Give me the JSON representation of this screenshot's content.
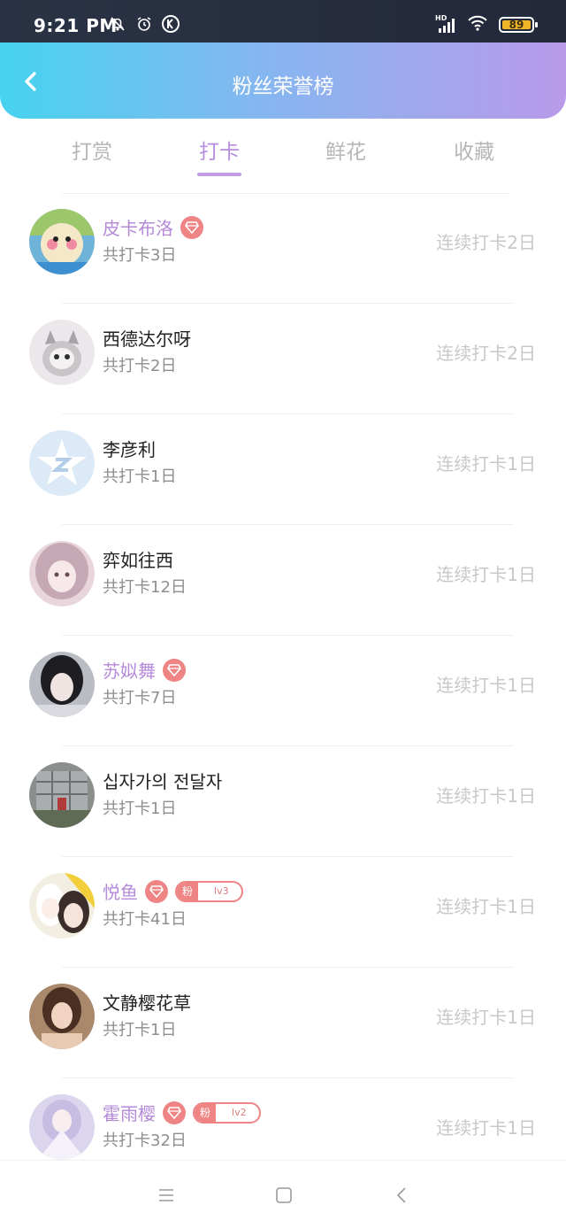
{
  "status_bar": {
    "time": "9:21 PM",
    "battery": "89",
    "hd": "HD",
    "battery_level_percent": 89
  },
  "header": {
    "title": "粉丝荣誉榜"
  },
  "tabs": [
    {
      "label": "打赏",
      "active": false
    },
    {
      "label": "打卡",
      "active": true
    },
    {
      "label": "鲜花",
      "active": false
    },
    {
      "label": "收藏",
      "active": false
    }
  ],
  "fans": [
    {
      "name": "皮卡布洛",
      "vip": true,
      "checkin": "共打卡3日",
      "streak": "连续打卡2日",
      "fan_badge": null
    },
    {
      "name": "西德达尔呀",
      "vip": false,
      "checkin": "共打卡2日",
      "streak": "连续打卡2日",
      "fan_badge": null
    },
    {
      "name": "李彦利",
      "vip": false,
      "checkin": "共打卡1日",
      "streak": "连续打卡1日",
      "fan_badge": null
    },
    {
      "name": "弈如往西",
      "vip": false,
      "checkin": "共打卡12日",
      "streak": "连续打卡1日",
      "fan_badge": null
    },
    {
      "name": "苏姒舞",
      "vip": true,
      "checkin": "共打卡7日",
      "streak": "连续打卡1日",
      "fan_badge": null
    },
    {
      "name": "십자가의 전달자",
      "vip": false,
      "checkin": "共打卡1日",
      "streak": "连续打卡1日",
      "fan_badge": null
    },
    {
      "name": "悦鱼",
      "vip": true,
      "checkin": "共打卡41日",
      "streak": "连续打卡1日",
      "fan_badge": {
        "label": "粉",
        "level": "lv3"
      }
    },
    {
      "name": "文静樱花草",
      "vip": false,
      "checkin": "共打卡1日",
      "streak": "连续打卡1日",
      "fan_badge": null
    },
    {
      "name": "霍雨樱",
      "vip": true,
      "checkin": "共打卡32日",
      "streak": "连续打卡1日",
      "fan_badge": {
        "label": "粉",
        "level": "lv2"
      }
    }
  ],
  "icons": {
    "back": "chevron-left-icon",
    "vip": "diamond-icon",
    "nav": [
      "menu-icon",
      "home-square-icon",
      "back-triangle-icon"
    ]
  },
  "colors": {
    "accent": "#b68de0",
    "vip_badge": "#ee8484",
    "header_start": "#46d3f0",
    "header_end": "#b89ae9"
  }
}
